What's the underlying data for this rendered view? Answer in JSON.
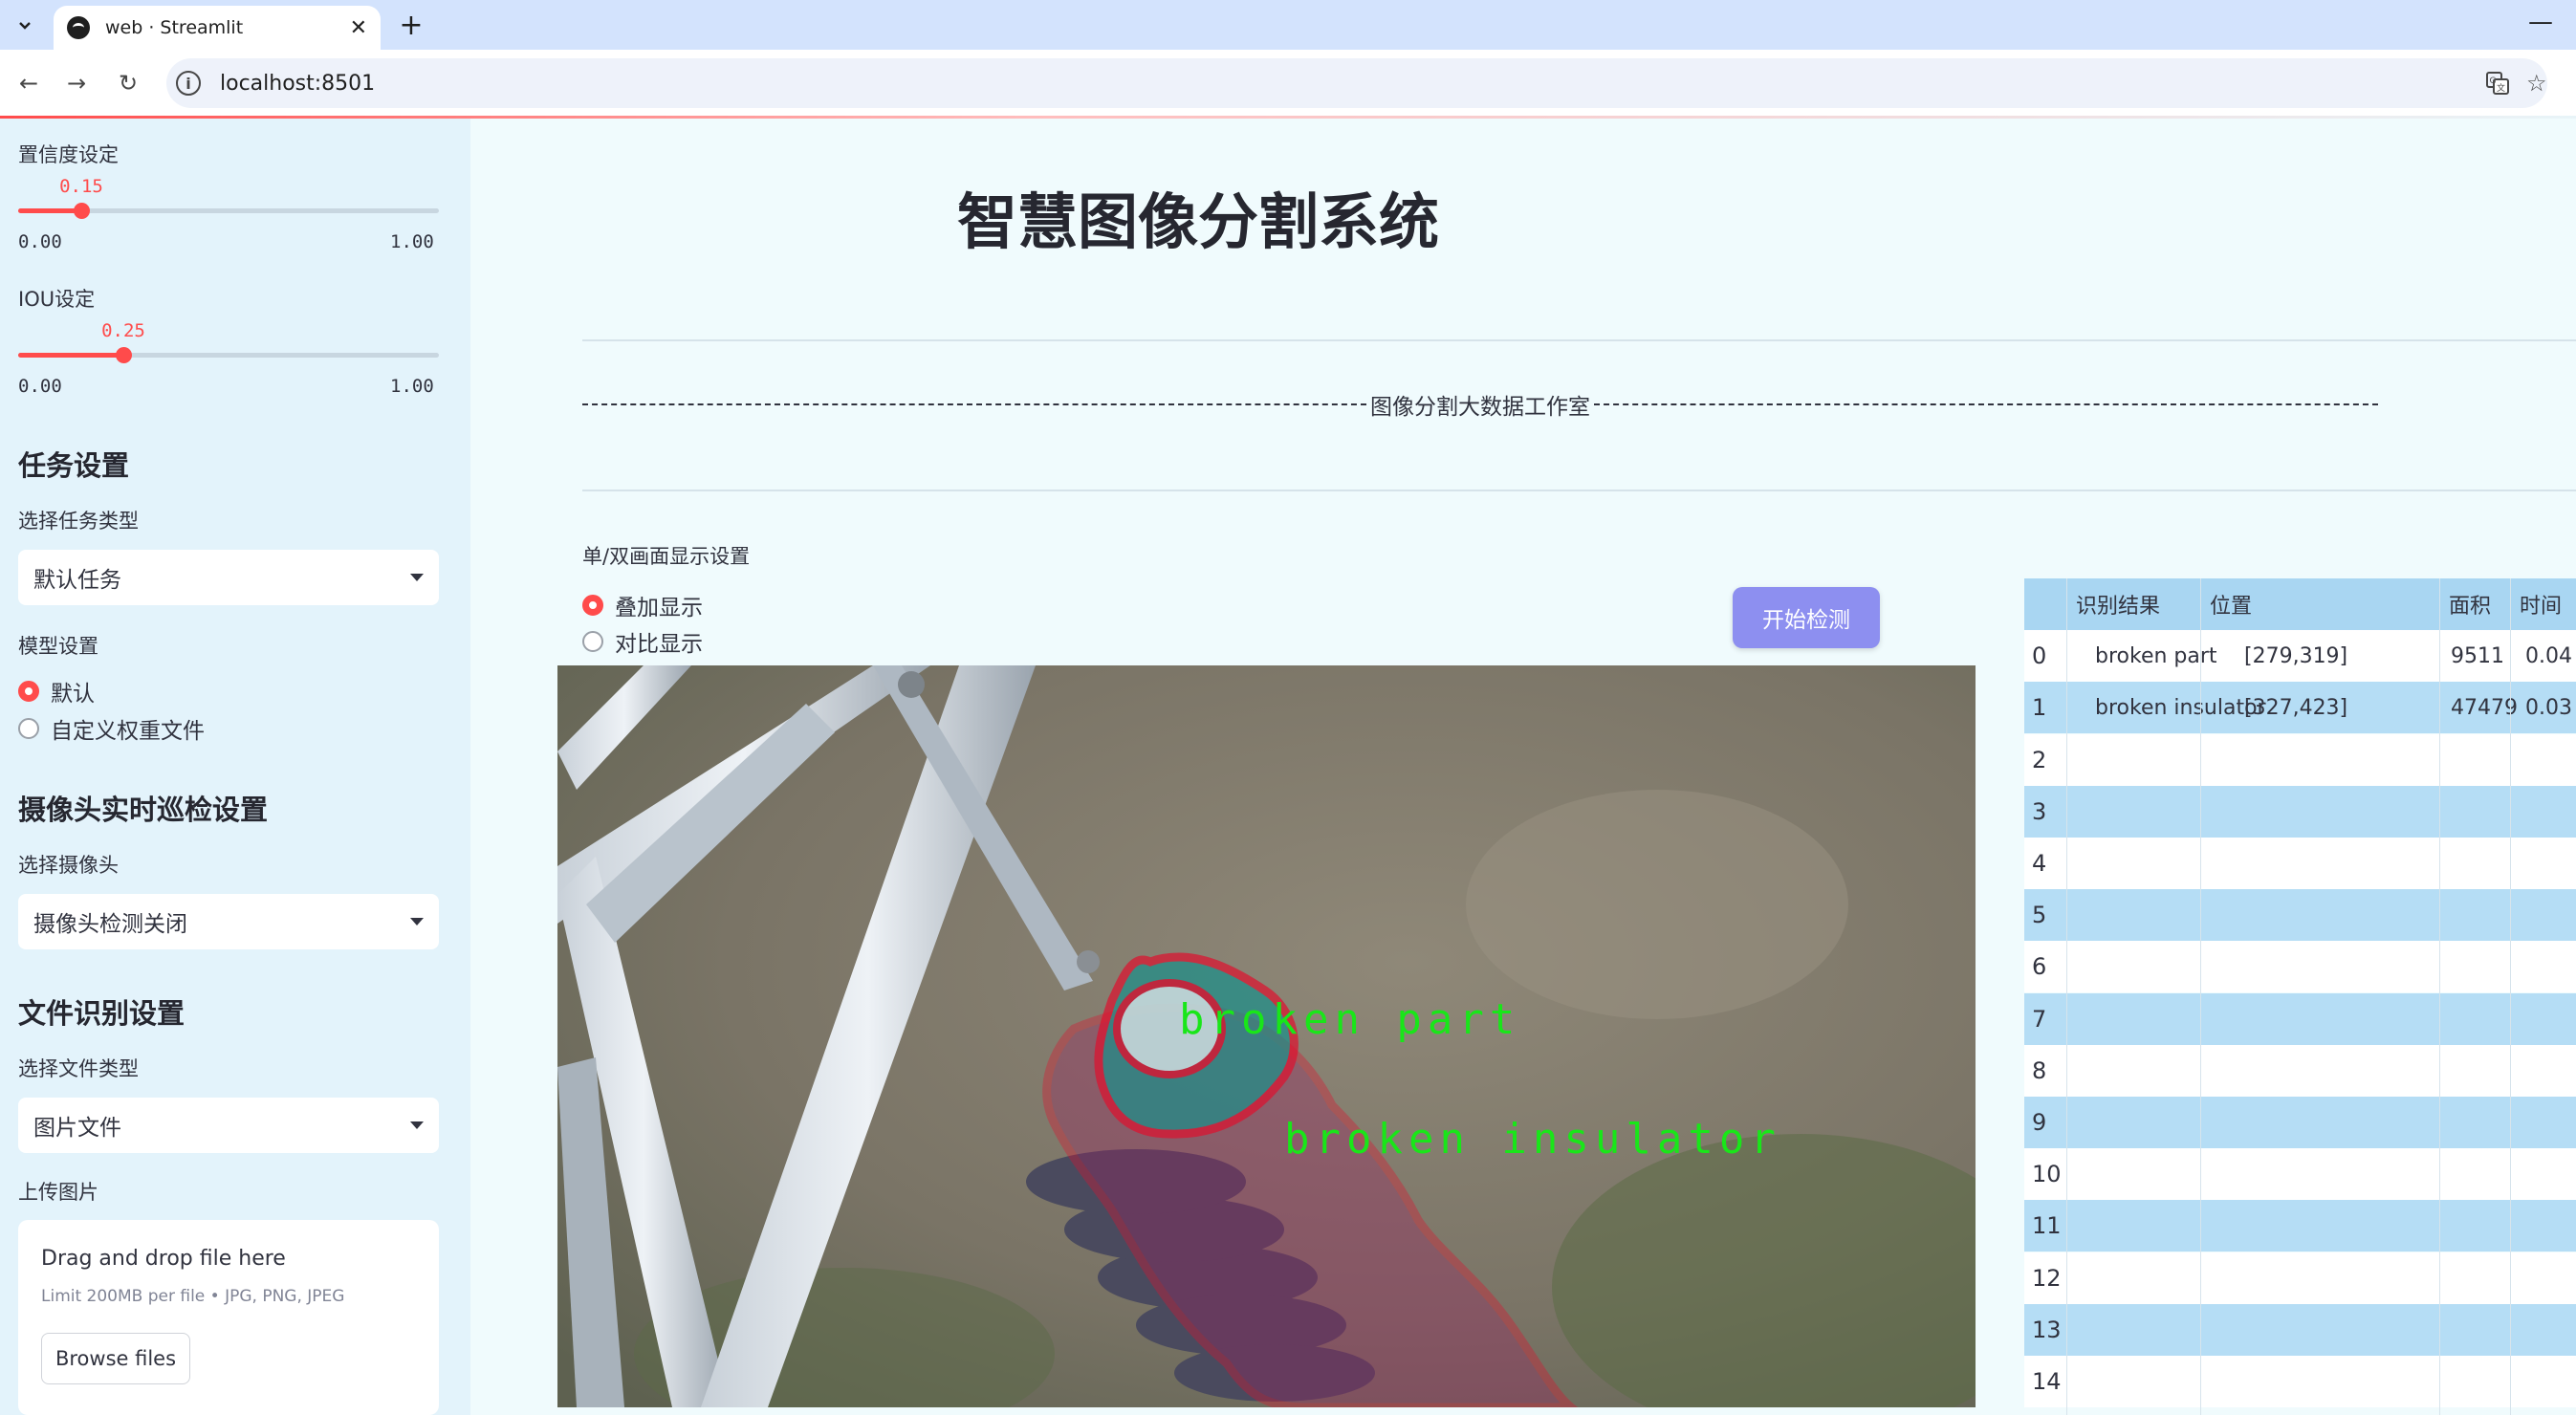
{
  "browser": {
    "tab_title": "web · Streamlit",
    "url": "localhost:8501"
  },
  "sidebar": {
    "confidence": {
      "label": "置信度设定",
      "value_text": "0.15",
      "value": 0.15,
      "min": "0.00",
      "max": "1.00"
    },
    "iou": {
      "label": "IOU设定",
      "value_text": "0.25",
      "value": 0.25,
      "min": "0.00",
      "max": "1.00"
    },
    "task_heading": "任务设置",
    "task_type_label": "选择任务类型",
    "task_type_value": "默认任务",
    "model_label": "模型设置",
    "model_options": [
      "默认",
      "自定义权重文件"
    ],
    "camera_heading": "摄像头实时巡检设置",
    "camera_label": "选择摄像头",
    "camera_value": "摄像头检测关闭",
    "file_heading": "文件识别设置",
    "file_type_label": "选择文件类型",
    "file_type_value": "图片文件",
    "upload_label": "上传图片",
    "upload_title": "Drag and drop file here",
    "upload_limit": "Limit 200MB per file • JPG, PNG, JPEG",
    "browse_label": "Browse files"
  },
  "main": {
    "title": "智慧图像分割系统",
    "studio_text": "图像分割大数据工作室",
    "display_label": "单/双画面显示设置",
    "display_options": [
      "叠加显示",
      "对比显示"
    ],
    "start_button": "开始检测",
    "overlay_labels": [
      "broken part",
      "broken insulator"
    ]
  },
  "table": {
    "headers": [
      "识别结果",
      "位置",
      "面积",
      "时间"
    ],
    "rows": [
      {
        "index": "0",
        "result": "broken part",
        "position": "[279,319]",
        "area": "9511",
        "time": "0.04"
      },
      {
        "index": "1",
        "result": "broken insulator",
        "position": "[327,423]",
        "area": "47479",
        "time": "0.03"
      },
      {
        "index": "2"
      },
      {
        "index": "3"
      },
      {
        "index": "4"
      },
      {
        "index": "5"
      },
      {
        "index": "6"
      },
      {
        "index": "7"
      },
      {
        "index": "8"
      },
      {
        "index": "9"
      },
      {
        "index": "10"
      },
      {
        "index": "11"
      },
      {
        "index": "12"
      },
      {
        "index": "13"
      },
      {
        "index": "14"
      }
    ]
  },
  "colors": {
    "accent": "#ff4b4b",
    "button": "#8d8ff0",
    "mask_outline": "#e0102e",
    "label_green": "#19e619"
  }
}
